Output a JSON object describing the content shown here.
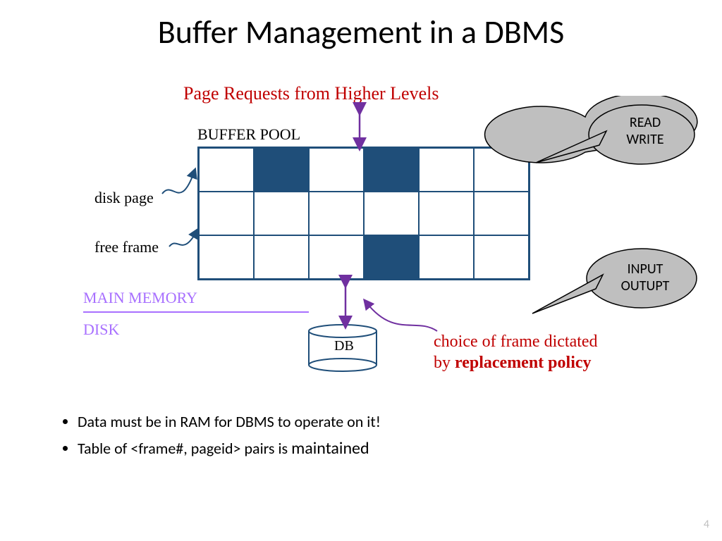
{
  "title": "Buffer Management in a DBMS",
  "page_requests_label": "Page Requests from Higher Levels",
  "buffer_pool_label": "BUFFER POOL",
  "disk_page_label": "disk page",
  "free_frame_label": "free frame",
  "main_memory_label": "MAIN MEMORY",
  "disk_label": "DISK",
  "db_label": "DB",
  "callout_read": "READ",
  "callout_write": "WRITE",
  "callout_input": "INPUT",
  "callout_output": "OUTUPT",
  "choice_line1": "choice of frame dictated",
  "choice_line2_prefix": "by ",
  "choice_line2_bold": "replacement policy",
  "bullet1": "Data must be in RAM for DBMS to operate on it!",
  "bullet2_a": "Table of <frame#, pageid> pairs is ",
  "bullet2_b": "maintained",
  "page_number": "4",
  "grid": {
    "rows": 3,
    "cols": 6,
    "filled_cells": [
      [
        0,
        1
      ],
      [
        0,
        3
      ],
      [
        2,
        3
      ]
    ]
  }
}
